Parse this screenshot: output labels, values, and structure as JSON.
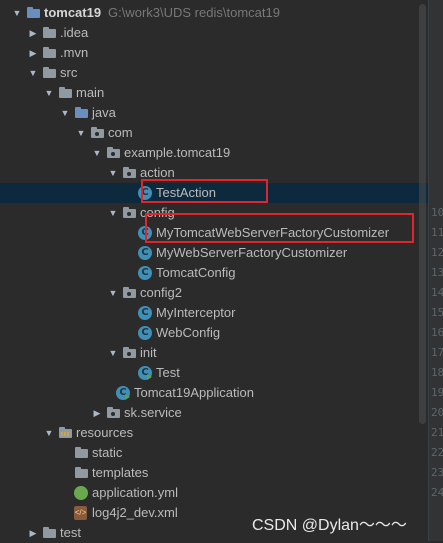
{
  "project": {
    "name": "tomcat19",
    "path": "G:\\work3\\UDS redis\\tomcat19"
  },
  "tree": [
    {
      "label": "tomcat19",
      "kind": "folder-blue",
      "expanded": true
    },
    {
      "label": ".idea",
      "kind": "folder",
      "expanded": false
    },
    {
      "label": ".mvn",
      "kind": "folder",
      "expanded": false
    },
    {
      "label": "src",
      "kind": "folder",
      "expanded": true
    },
    {
      "label": "main",
      "kind": "folder",
      "expanded": true
    },
    {
      "label": "java",
      "kind": "folder-blue",
      "expanded": true
    },
    {
      "label": "com",
      "kind": "package",
      "expanded": true
    },
    {
      "label": "example.tomcat19",
      "kind": "package",
      "expanded": true
    },
    {
      "label": "action",
      "kind": "package",
      "expanded": true
    },
    {
      "label": "TestAction",
      "kind": "class"
    },
    {
      "label": "config",
      "kind": "package",
      "expanded": true
    },
    {
      "label": "MyTomcatWebServerFactoryCustomizer",
      "kind": "class"
    },
    {
      "label": "MyWebServerFactoryCustomizer",
      "kind": "class"
    },
    {
      "label": "TomcatConfig",
      "kind": "class"
    },
    {
      "label": "config2",
      "kind": "package",
      "expanded": true
    },
    {
      "label": "MyInterceptor",
      "kind": "class"
    },
    {
      "label": "WebConfig",
      "kind": "class"
    },
    {
      "label": "init",
      "kind": "package",
      "expanded": true
    },
    {
      "label": "Test",
      "kind": "class-run"
    },
    {
      "label": "Tomcat19Application",
      "kind": "class-app"
    },
    {
      "label": "sk.service",
      "kind": "package",
      "expanded": false
    },
    {
      "label": "resources",
      "kind": "folder-res",
      "expanded": true
    },
    {
      "label": "static",
      "kind": "folder"
    },
    {
      "label": "templates",
      "kind": "folder"
    },
    {
      "label": "application.yml",
      "kind": "yml"
    },
    {
      "label": "log4j2_dev.xml",
      "kind": "xml"
    },
    {
      "label": "test",
      "kind": "folder",
      "expanded": false
    }
  ],
  "line_numbers": [
    "",
    "",
    "",
    "",
    "",
    "",
    "",
    "",
    "",
    "",
    "10",
    "11",
    "12",
    "13",
    "14",
    "15",
    "16",
    "17",
    "18",
    "19",
    "20",
    "21",
    "22",
    "23",
    "24",
    "",
    ""
  ],
  "watermark": "CSDN @Dylan～～～",
  "colors": {
    "background": "#2b2b2b",
    "selection": "#0d293e",
    "highlight_border": "#e0262c",
    "class_icon": "#3f8fb7"
  }
}
